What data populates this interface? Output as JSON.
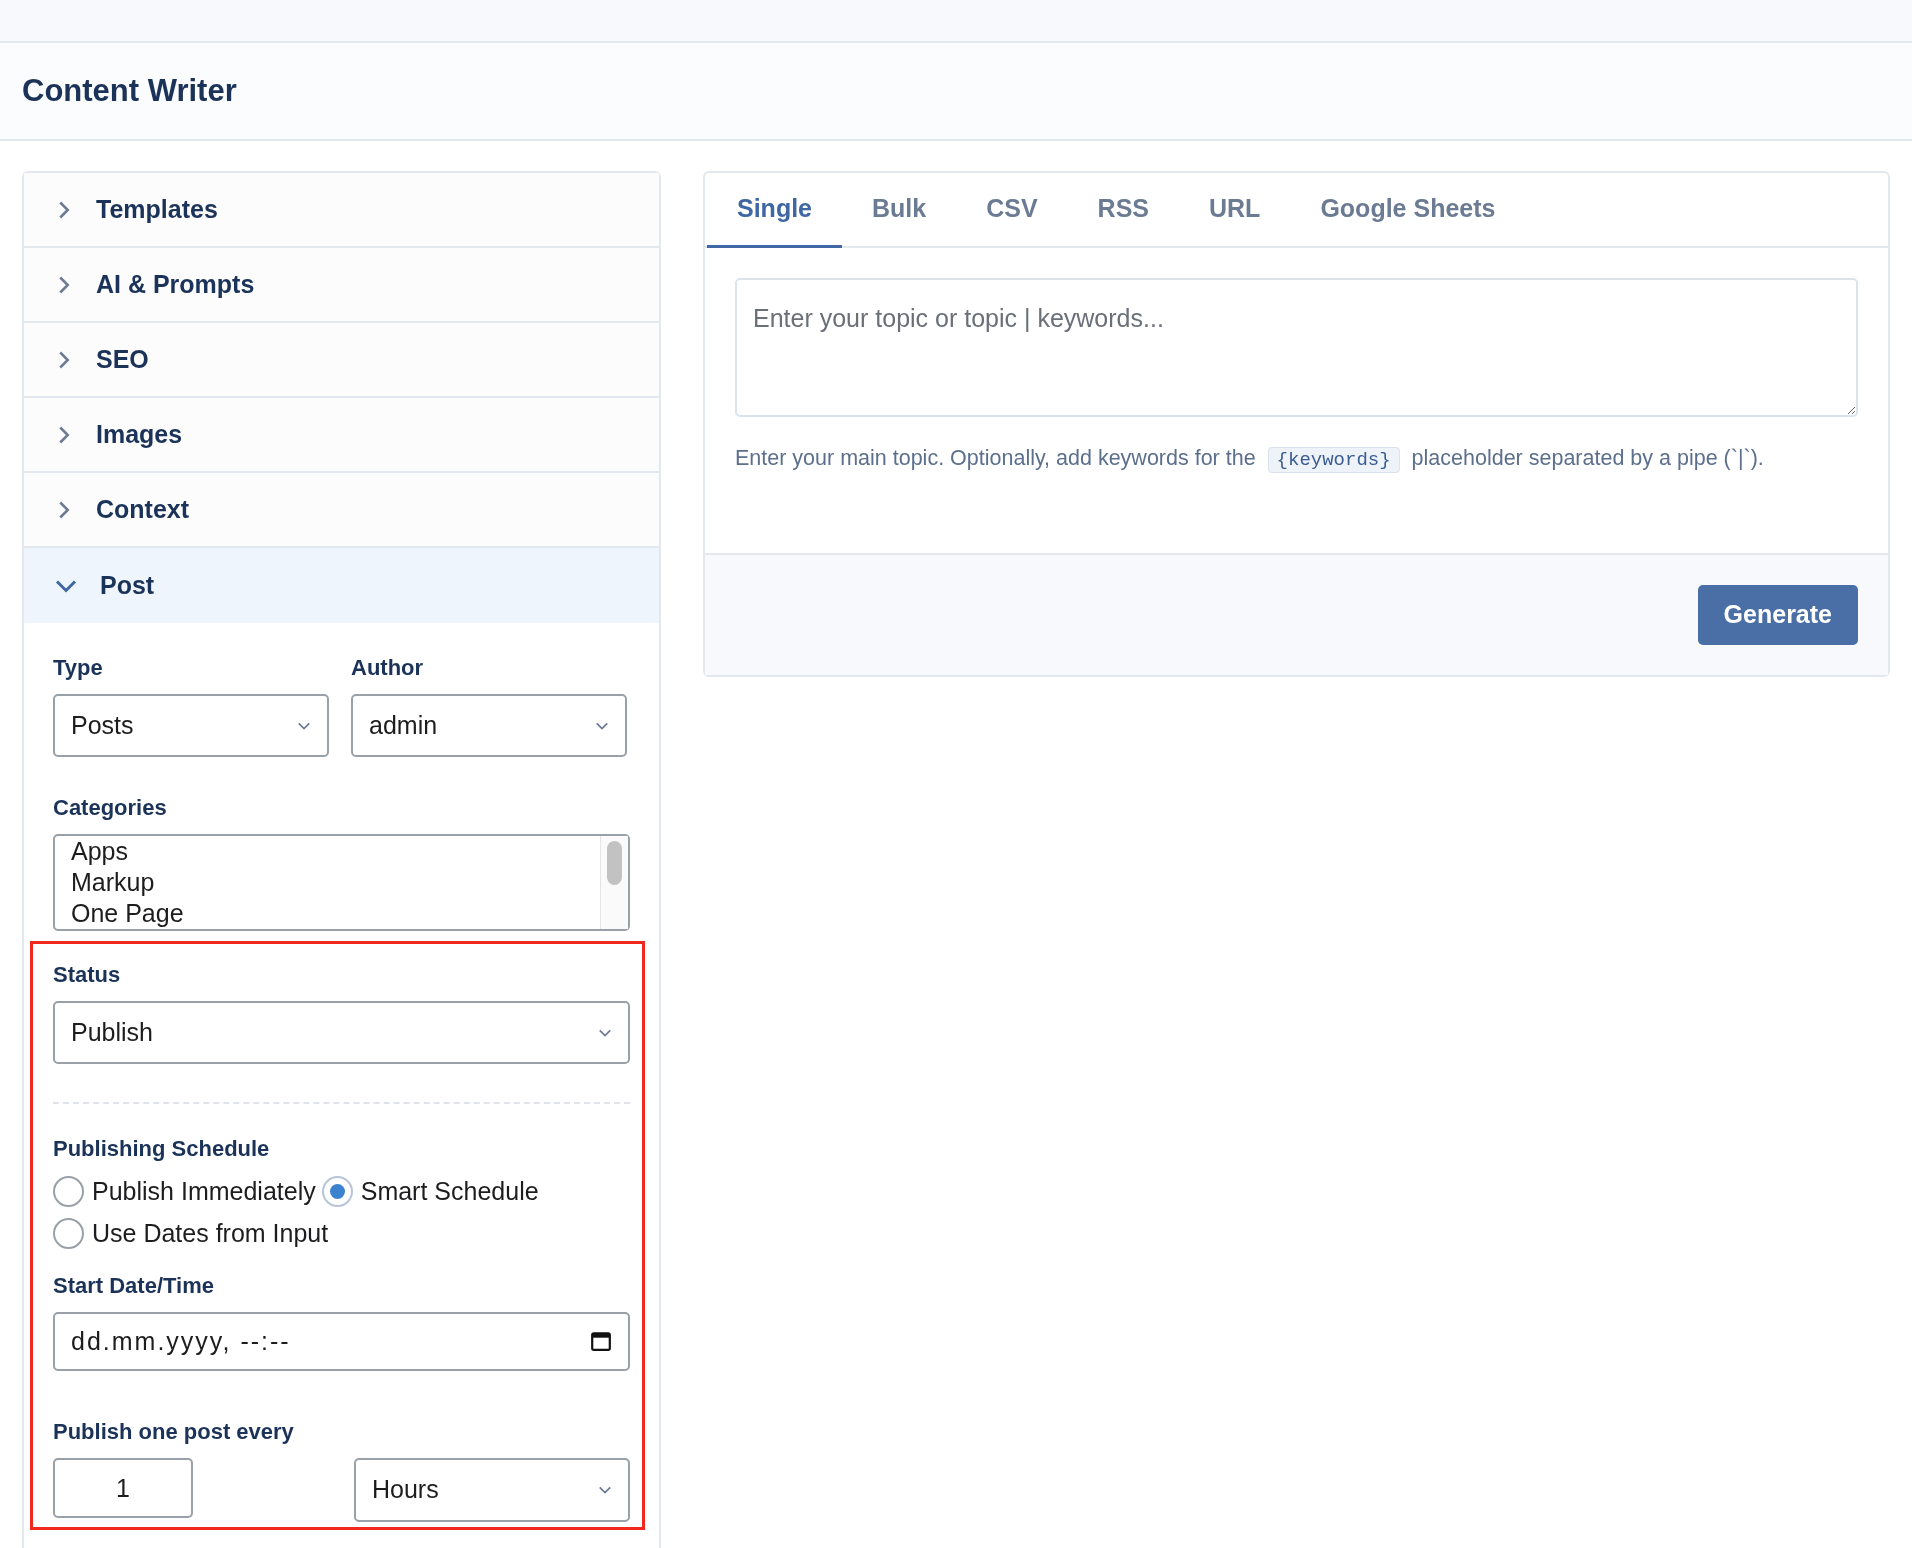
{
  "page": {
    "title": "Content Writer"
  },
  "accordion": [
    {
      "label": "Templates",
      "expanded": false
    },
    {
      "label": "AI & Prompts",
      "expanded": false
    },
    {
      "label": "SEO",
      "expanded": false
    },
    {
      "label": "Images",
      "expanded": false
    },
    {
      "label": "Context",
      "expanded": false
    },
    {
      "label": "Post",
      "expanded": true
    }
  ],
  "post": {
    "type": {
      "label": "Type",
      "value": "Posts"
    },
    "author": {
      "label": "Author",
      "value": "admin"
    },
    "categories": {
      "label": "Categories",
      "options": [
        "Apps",
        "Markup",
        "One Page"
      ]
    },
    "status": {
      "label": "Status",
      "value": "Publish"
    },
    "schedule": {
      "label": "Publishing Schedule",
      "options": [
        {
          "label": "Publish Immediately",
          "selected": false
        },
        {
          "label": "Smart Schedule",
          "selected": true
        },
        {
          "label": "Use Dates from Input",
          "selected": false
        }
      ]
    },
    "start": {
      "label": "Start Date/Time",
      "placeholder": "dd.mm.yyyy, --:--"
    },
    "interval": {
      "label": "Publish one post every",
      "value": "1",
      "unit": "Hours"
    }
  },
  "tabs": [
    {
      "label": "Single",
      "selected": true
    },
    {
      "label": "Bulk",
      "selected": false
    },
    {
      "label": "CSV",
      "selected": false
    },
    {
      "label": "RSS",
      "selected": false
    },
    {
      "label": "URL",
      "selected": false
    },
    {
      "label": "Google Sheets",
      "selected": false
    }
  ],
  "topic": {
    "placeholder": "Enter your topic or topic | keywords...",
    "help_before": "Enter your main topic. Optionally, add keywords for the",
    "help_code": "{keywords}",
    "help_after": "placeholder separated by a pipe (`|`)."
  },
  "generate_button": "Generate"
}
